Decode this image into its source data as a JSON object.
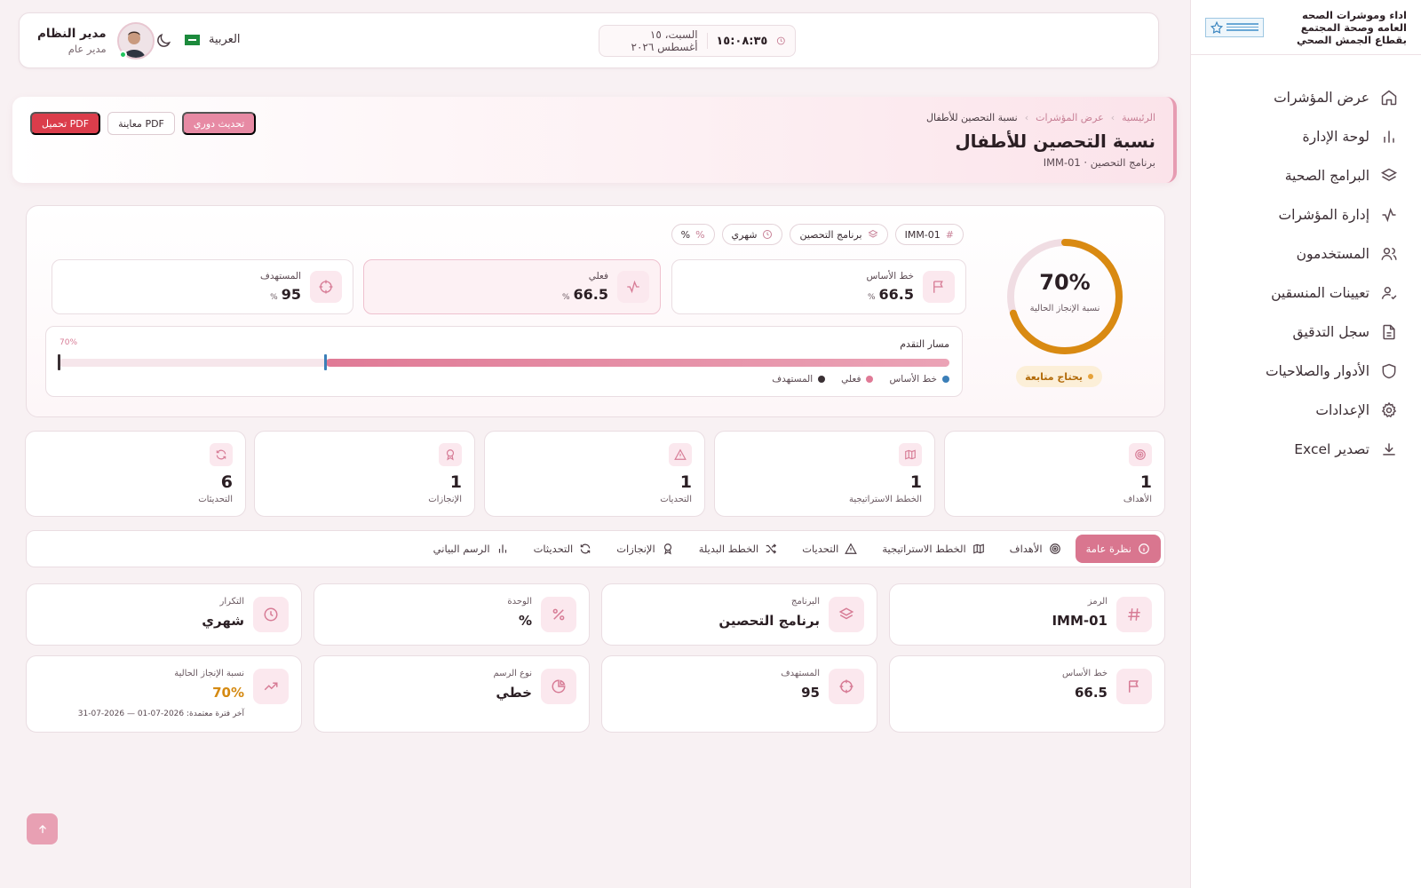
{
  "app": {
    "title": "اداء وموشرات الصحه العامه وصحة المجتمع بقطاع الجمش الصحي"
  },
  "sidebar": {
    "items": [
      {
        "label": "عرض المؤشرات",
        "icon": "home-icon"
      },
      {
        "label": "لوحة الإدارة",
        "icon": "bar-chart-icon"
      },
      {
        "label": "البرامج الصحية",
        "icon": "layers-icon"
      },
      {
        "label": "إدارة المؤشرات",
        "icon": "activity-icon"
      },
      {
        "label": "المستخدمون",
        "icon": "users-icon"
      },
      {
        "label": "تعيينات المنسقين",
        "icon": "user-check-icon"
      },
      {
        "label": "سجل التدقيق",
        "icon": "file-text-icon"
      },
      {
        "label": "الأدوار والصلاحيات",
        "icon": "shield-icon"
      },
      {
        "label": "الإعدادات",
        "icon": "gear-icon"
      },
      {
        "label": "تصدير Excel",
        "icon": "download-icon"
      }
    ]
  },
  "header": {
    "user_name": "مدير النظام",
    "user_role": "مدير عام",
    "language": "العربية",
    "time": "١٥:٠٨:٣٥",
    "date": "السبت، ١٥ أغسطس ٢٠٢٦"
  },
  "hero": {
    "breadcrumb": [
      "الرئيسية",
      "عرض المؤشرات",
      "نسبة التحصين للأطفال"
    ],
    "title": "نسبة التحصين للأطفال",
    "subtitle": "برنامج التحصين · IMM-01",
    "actions": {
      "download": "تحميل PDF",
      "preview": "معاينة PDF",
      "update": "تحديث دوري"
    }
  },
  "summary": {
    "gauge_value": "70%",
    "gauge_fraction": 0.7,
    "gauge_label": "نسبة الإنجاز الحالية",
    "status": "يحتاج متابعة",
    "chips": [
      "IMM-01",
      "برنامج التحصين",
      "شهري",
      "%"
    ],
    "metrics": [
      {
        "label": "خط الأساس",
        "value": "66.5",
        "unit": "%"
      },
      {
        "label": "فعلي",
        "value": "66.5",
        "unit": "%"
      },
      {
        "label": "المستهدف",
        "value": "95",
        "unit": "%"
      }
    ],
    "track": {
      "title": "مسار التقدم",
      "percent": "70%",
      "scale_max": 95,
      "baseline": 66.5,
      "actual": 66.5,
      "target": 95,
      "legend": [
        "خط الأساس",
        "فعلي",
        "المستهدف"
      ]
    }
  },
  "stats": [
    {
      "label": "الأهداف",
      "value": "1",
      "icon": "target-icon"
    },
    {
      "label": "الخطط الاستراتيجية",
      "value": "1",
      "icon": "map-icon"
    },
    {
      "label": "التحديات",
      "value": "1",
      "icon": "alert-triangle-icon"
    },
    {
      "label": "الإنجازات",
      "value": "1",
      "icon": "award-icon"
    },
    {
      "label": "التحديثات",
      "value": "6",
      "icon": "refresh-icon"
    }
  ],
  "tabs": [
    {
      "label": "نظرة عامة",
      "icon": "info-icon"
    },
    {
      "label": "الأهداف",
      "icon": "target-icon"
    },
    {
      "label": "الخطط الاستراتيجية",
      "icon": "map-icon"
    },
    {
      "label": "التحديات",
      "icon": "alert-triangle-icon"
    },
    {
      "label": "الخطط البديلة",
      "icon": "shuffle-icon"
    },
    {
      "label": "الإنجازات",
      "icon": "award-icon"
    },
    {
      "label": "التحديثات",
      "icon": "refresh-icon"
    },
    {
      "label": "الرسم البياني",
      "icon": "bar-chart-icon"
    }
  ],
  "info": [
    {
      "label": "الرمز",
      "value": "IMM-01",
      "icon": "hash-icon"
    },
    {
      "label": "البرنامج",
      "value": "برنامج التحصين",
      "icon": "layers-icon"
    },
    {
      "label": "الوحدة",
      "value": "%",
      "icon": "percent-icon"
    },
    {
      "label": "التكرار",
      "value": "شهري",
      "icon": "clock-icon"
    },
    {
      "label": "خط الأساس",
      "value": "66.5",
      "icon": "flag-icon"
    },
    {
      "label": "المستهدف",
      "value": "95",
      "icon": "crosshair-icon"
    },
    {
      "label": "نوع الرسم",
      "value": "خطي",
      "icon": "pie-chart-icon"
    },
    {
      "label": "نسبة الإنجاز الحالية",
      "value": "70%",
      "icon": "trending-up-icon",
      "note": "آخر فترة معتمدة: 2026-07-01 — 2026-07-31"
    }
  ],
  "colors": {
    "accent": "#d9768f",
    "danger": "#db3d4b",
    "warning": "#d58a12",
    "gauge": "#d98a12",
    "baseline": "#3b7fb8",
    "actual": "#e07a96",
    "target": "#3a3034"
  }
}
